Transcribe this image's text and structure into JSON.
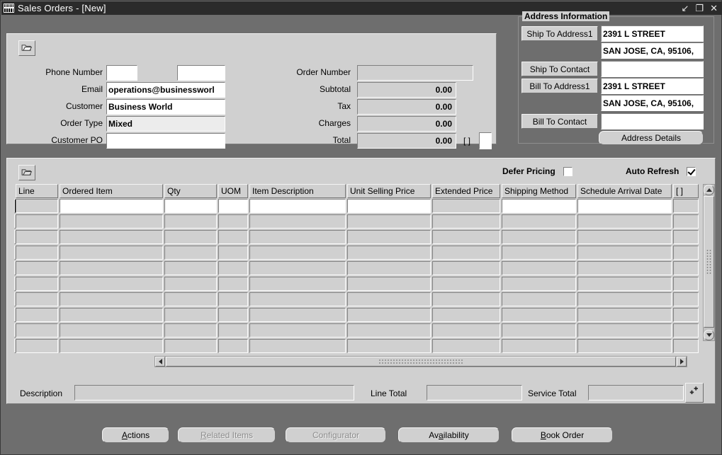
{
  "window": {
    "title": "Sales Orders - [New]",
    "icon": "form-icon",
    "controls": [
      {
        "name": "minimize-button",
        "glyph": "↙"
      },
      {
        "name": "restore-button",
        "glyph": "❐"
      },
      {
        "name": "close-button",
        "glyph": "✕"
      }
    ]
  },
  "header": {
    "open_folder_tooltip": "Folder",
    "fields": [
      {
        "label": "Phone Number",
        "value": "",
        "placeholder": "",
        "readonly": false
      },
      {
        "label": "Email",
        "value": "operations@businessworl",
        "placeholder": "",
        "readonly": false
      },
      {
        "label": "Customer",
        "value": "Business World",
        "placeholder": "",
        "readonly": false
      },
      {
        "label": "Order Type",
        "value": "Mixed",
        "placeholder": "",
        "readonly": true
      },
      {
        "label": "Customer PO",
        "value": "",
        "placeholder": "",
        "readonly": false
      }
    ],
    "phone_ext_value": "",
    "totals": [
      {
        "label": "Order Number",
        "value": ""
      },
      {
        "label": "Subtotal",
        "value": "0.00"
      },
      {
        "label": "Tax",
        "value": "0.00"
      },
      {
        "label": "Charges",
        "value": "0.00"
      },
      {
        "label": "Total",
        "value": "0.00"
      }
    ],
    "flexfield_label": "[ ]",
    "flexfield_value": ""
  },
  "address": {
    "group_title": "Address Information",
    "rows": [
      {
        "button": "Ship To Address1",
        "value": "2391 L STREET"
      },
      {
        "button": "",
        "value": "SAN JOSE, CA, 95106,"
      },
      {
        "button": "Ship To Contact",
        "value": ""
      },
      {
        "button": "Bill To Address1",
        "value": "2391 L STREET"
      },
      {
        "button": "",
        "value": "SAN JOSE, CA, 95106,"
      },
      {
        "button": "Bill To Contact",
        "value": ""
      }
    ],
    "details_button": "Address Details"
  },
  "lines": {
    "defer_pricing_label": "Defer Pricing",
    "defer_pricing_checked": false,
    "auto_refresh_label": "Auto Refresh",
    "auto_refresh_checked": true,
    "columns": [
      {
        "label": "Line",
        "readonly": true
      },
      {
        "label": "Ordered Item",
        "readonly": false
      },
      {
        "label": "Qty",
        "readonly": false
      },
      {
        "label": "UOM",
        "readonly": false
      },
      {
        "label": "Item Description",
        "readonly": false
      },
      {
        "label": "Unit Selling Price",
        "readonly": false
      },
      {
        "label": "Extended Price",
        "readonly": true
      },
      {
        "label": "Shipping Method",
        "readonly": false
      },
      {
        "label": "Schedule Arrival Date",
        "readonly": false
      },
      {
        "label": "[ ]",
        "readonly": true
      }
    ],
    "rows": [
      {
        "current": true,
        "cells": [
          "",
          "",
          "",
          "",
          "",
          "",
          "",
          "",
          "",
          ""
        ]
      },
      {
        "current": false,
        "cells": [
          "",
          "",
          "",
          "",
          "",
          "",
          "",
          "",
          "",
          ""
        ]
      },
      {
        "current": false,
        "cells": [
          "",
          "",
          "",
          "",
          "",
          "",
          "",
          "",
          "",
          ""
        ]
      },
      {
        "current": false,
        "cells": [
          "",
          "",
          "",
          "",
          "",
          "",
          "",
          "",
          "",
          ""
        ]
      },
      {
        "current": false,
        "cells": [
          "",
          "",
          "",
          "",
          "",
          "",
          "",
          "",
          "",
          ""
        ]
      },
      {
        "current": false,
        "cells": [
          "",
          "",
          "",
          "",
          "",
          "",
          "",
          "",
          "",
          ""
        ]
      },
      {
        "current": false,
        "cells": [
          "",
          "",
          "",
          "",
          "",
          "",
          "",
          "",
          "",
          ""
        ]
      },
      {
        "current": false,
        "cells": [
          "",
          "",
          "",
          "",
          "",
          "",
          "",
          "",
          "",
          ""
        ]
      },
      {
        "current": false,
        "cells": [
          "",
          "",
          "",
          "",
          "",
          "",
          "",
          "",
          "",
          ""
        ]
      },
      {
        "current": false,
        "cells": [
          "",
          "",
          "",
          "",
          "",
          "",
          "",
          "",
          "",
          ""
        ]
      }
    ]
  },
  "footer": {
    "description_label": "Description",
    "description_value": "",
    "line_total_label": "Line Total",
    "line_total_value": "",
    "service_total_label": "Service Total",
    "service_total_value": "",
    "extra_icon": "catalog-icon"
  },
  "actions": [
    {
      "label": "Actions",
      "mnemonic": "A",
      "enabled": true
    },
    {
      "label": "Related Items",
      "mnemonic": "R",
      "enabled": false
    },
    {
      "label": "Configurator",
      "mnemonic": "g",
      "enabled": false
    },
    {
      "label": "Availability",
      "mnemonic": "a",
      "enabled": true
    },
    {
      "label": "Book Order",
      "mnemonic": "B",
      "enabled": true
    }
  ],
  "colors": {
    "window_bg": "#6e6e6e",
    "panel_bg": "#d0d0d0",
    "titlebar_bg": "#2b2b2b",
    "field_bg": "#ffffff",
    "readonly_bg": "#d0d0d0"
  }
}
